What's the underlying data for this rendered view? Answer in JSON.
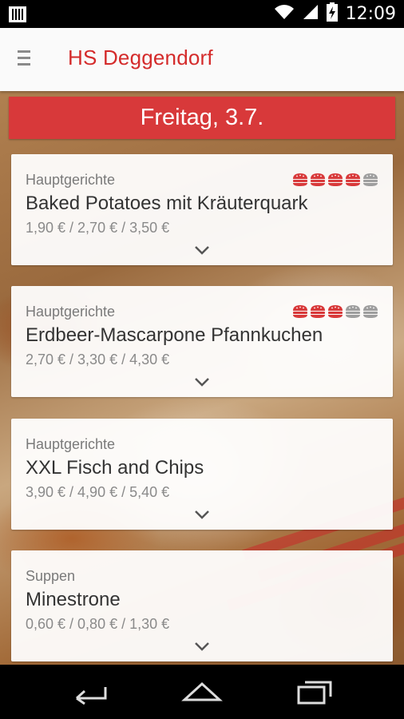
{
  "status_bar": {
    "time": "12:09",
    "icons": [
      "sim-icon",
      "wifi-icon",
      "signal-icon",
      "battery-charging-icon"
    ]
  },
  "app_bar": {
    "title": "HS Deggendorf",
    "menu_icon": "menu-icon"
  },
  "day": {
    "label": "Freitag, 3.7."
  },
  "colors": {
    "brand_red": "#d42b2b",
    "banner_red": "#d8393a",
    "rating_active": "#d8393a",
    "rating_inactive": "#9e9e9e"
  },
  "meals": [
    {
      "category": "Hauptgerichte",
      "name": "Baked Potatoes mit Kräuterquark",
      "price": "1,90 € / 2,70 € / 3,50 €",
      "rating": 4,
      "rating_max": 5
    },
    {
      "category": "Hauptgerichte",
      "name": "Erdbeer-Mascarpone Pfannkuchen",
      "price": "2,70 € / 3,30 € / 4,30 €",
      "rating": 3,
      "rating_max": 5
    },
    {
      "category": "Hauptgerichte",
      "name": "XXL Fisch and Chips",
      "price": "3,90 € / 4,90 € / 5,40 €",
      "rating": null,
      "rating_max": null
    },
    {
      "category": "Suppen",
      "name": "Minestrone",
      "price": "0,60 € / 0,80 € / 1,30 €",
      "rating": null,
      "rating_max": null
    }
  ],
  "nav_bar": {
    "buttons": [
      "back-icon",
      "home-icon",
      "recents-icon"
    ]
  }
}
